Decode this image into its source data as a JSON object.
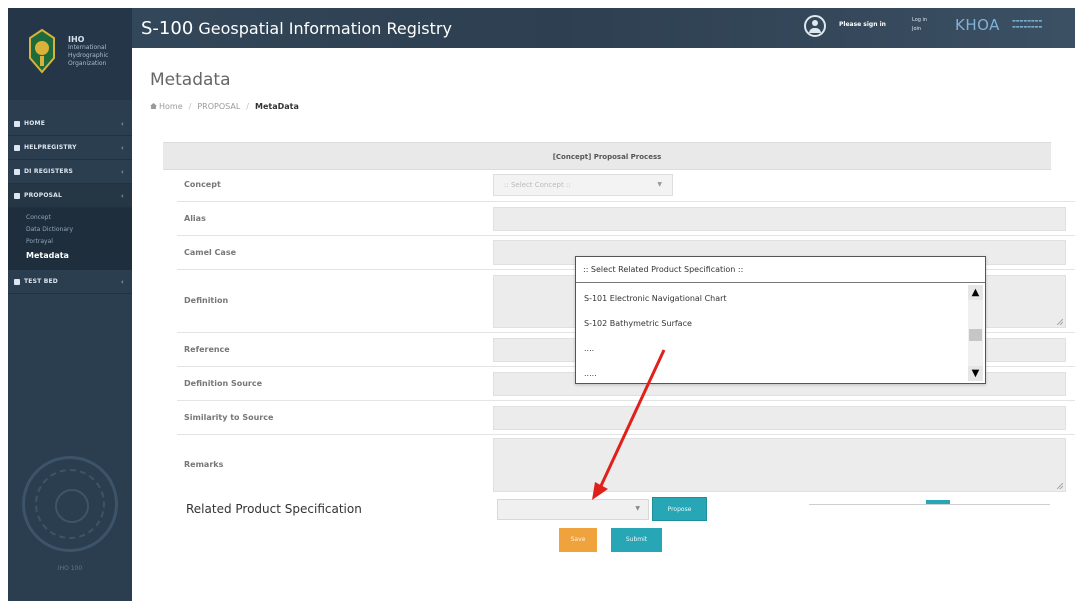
{
  "app": {
    "title_prefix": "S-100",
    "title_rest": " Geospatial Information Registry",
    "sign_in": "Please sign in",
    "login": "Log in",
    "join": "Join",
    "partner_logo": "KHOA"
  },
  "sidebar": {
    "logo_abbr": "IHO",
    "logo_text": "International Hydrographic Organization",
    "items": [
      {
        "label": "HOME",
        "icon": "home-icon"
      },
      {
        "label": "HELPREGISTRY",
        "icon": "registry-icon"
      },
      {
        "label": "DI REGISTERS",
        "icon": "register-icon"
      },
      {
        "label": "PROPOSAL",
        "icon": "proposal-icon"
      },
      {
        "label": "TEST BED",
        "icon": "testbed-icon"
      }
    ],
    "proposal_sub": [
      "Concept",
      "Data Dictionary",
      "Portrayal",
      "Metadata"
    ],
    "seal_caption": "IHO 100"
  },
  "page": {
    "title": "Metadata",
    "breadcrumb": [
      "Home",
      "PROPOSAL",
      "MetaData"
    ]
  },
  "form": {
    "header": "[Concept] Proposal Process",
    "labels": {
      "concept": "Concept",
      "alias": "Alias",
      "camel_case": "Camel Case",
      "definition": "Definition",
      "reference": "Reference",
      "definition_source": "Definition Source",
      "similarity": "Similarity to Source",
      "remarks": "Remarks"
    },
    "concept_placeholder": ":: Select Concept ::",
    "related_product_label": "Related Product Specification",
    "propose_button": "Propose",
    "save_button": "Save",
    "submit_button": "Submit"
  },
  "dropdown": {
    "header": ":: Select Related Product Specification ::",
    "options": [
      "S-101 Electronic Navigational Chart",
      "S-102 Bathymetric Surface",
      "....",
      "....."
    ]
  },
  "colors": {
    "sidebar_bg": "#2b3e50",
    "accent_teal": "#27a6b5",
    "save_orange": "#f0a23c",
    "annotation_red": "#e0201b"
  }
}
